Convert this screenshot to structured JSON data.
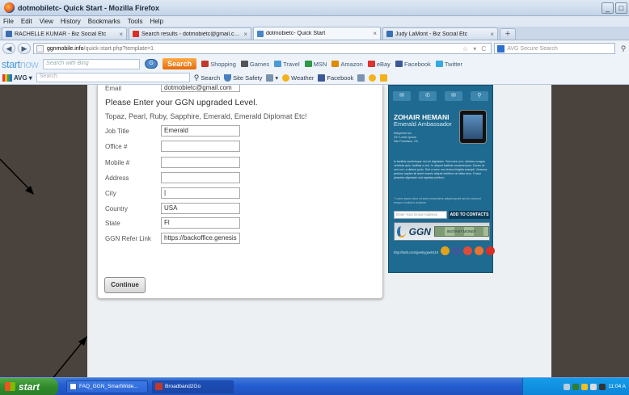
{
  "window": {
    "title": "dotmobiletc- Quick Start - Mozilla Firefox",
    "buttons": [
      "_",
      "□"
    ]
  },
  "menu": [
    "File",
    "Edit",
    "View",
    "History",
    "Bookmarks",
    "Tools",
    "Help"
  ],
  "tabs": [
    {
      "label": "RACHELLE KUMAR - Biz Social Etc",
      "color": "#3a6fb0"
    },
    {
      "label": "Search results - dotmobietc@gmail.com - ...",
      "color": "#d93025"
    },
    {
      "label": "dotmobietc- Quick Start",
      "color": "#4a86c5"
    },
    {
      "label": "Judy LaMont - Biz Social Etc",
      "color": "#3a6fb0"
    }
  ],
  "new_tab": "+",
  "nav": {
    "url_domain": "ggnmobile.info",
    "url_path": "/quick-start.php?template=1",
    "search_placeholder": "AVG Secure Search"
  },
  "startnow": {
    "logo_a": "start",
    "logo_b": "now",
    "search_placeholder": "Search with Bing",
    "circle_label": "G",
    "search_label": "Search",
    "links": [
      {
        "label": "Shopping",
        "color": "#c0392b"
      },
      {
        "label": "Games",
        "color": "#555"
      },
      {
        "label": "Travel",
        "color": "#4a9bd7"
      },
      {
        "label": "MSN",
        "color": "#2b9a48"
      },
      {
        "label": "Amazon",
        "color": "#e08a00"
      },
      {
        "label": "eBay",
        "color": "#d33"
      },
      {
        "label": "Facebook",
        "color": "#3b5998"
      },
      {
        "label": "Twitter",
        "color": "#36a9e1"
      }
    ]
  },
  "avg": {
    "label": "AVG",
    "search_placeholder": "Search",
    "items": [
      {
        "label": "Search",
        "color": "#8aa"
      },
      {
        "label": "Site Safety",
        "color": "#4a7fc0"
      },
      {
        "label": "Weather",
        "color": "#f2b21b"
      },
      {
        "label": "Facebook",
        "color": "#3b5998"
      }
    ]
  },
  "form": {
    "email_label": "Email",
    "email_value": "dotmobietc@gmail.com",
    "heading": "Please Enter your GGN upgraded Level.",
    "levels": "Topaz, Pearl, Ruby, Sapphire, Emerald, Emerald Diplomat Etc!",
    "fields": [
      {
        "label": "Job Title",
        "value": "Emerald"
      },
      {
        "label": "Office #",
        "value": ""
      },
      {
        "label": "Mobile #",
        "value": ""
      },
      {
        "label": "Address",
        "value": ""
      },
      {
        "label": "City",
        "value": "|"
      },
      {
        "label": "Country",
        "value": "USA"
      },
      {
        "label": "State",
        "value": "Fl"
      },
      {
        "label": "GGN Refer Link",
        "value": "https://backoffice.genesis"
      }
    ],
    "continue_label": "Continue"
  },
  "promo": {
    "icons": [
      "✉",
      "✆",
      "✉",
      "⚲"
    ],
    "name": "ZOHAIR HEMANI",
    "title": "Emerald Ambassador",
    "address": "Edisphere Inc.\n237 Lorem Ipsum\nSan Francisco, CA",
    "body": "In facilisis scelerisque dui vel dignissim. Sed nunc orci, ultricies congue vehicula quis, facilisis a orci. In aliquet facilisis condimentum. Donec at orci orci, a dictum justo. Sed a nunc non lectus fringilla suscipit. Vivamus pretium sapien sit amet mauris aliquet eleifend vel vitae arcu. Fusce pharetra dignissim nisl egestas pretium.",
    "note": "* Lorem ipsum dolor sit amet consectetur adipiscing elit sed do eiusmod tempor incididunt ut labore.",
    "email_placeholder": "Enter Your Email Address",
    "add_button": "ADD TO CONTACTS",
    "ggn": "GGN",
    "banner": "INSTANT MONEY",
    "url": "http://twitr.com/geekygeek110",
    "social_colors": [
      "#e2a21b",
      "#3b5998",
      "#dd4b39",
      "#e9742f",
      "#d93025"
    ]
  },
  "taskbar": {
    "start": "start",
    "items": [
      {
        "label": "FAQ_GGN_SmartWide...",
        "color": "#2b5fb3"
      },
      {
        "label": "Broadband2Go",
        "color": "#c0392b"
      }
    ],
    "clock": "11:04 A"
  }
}
